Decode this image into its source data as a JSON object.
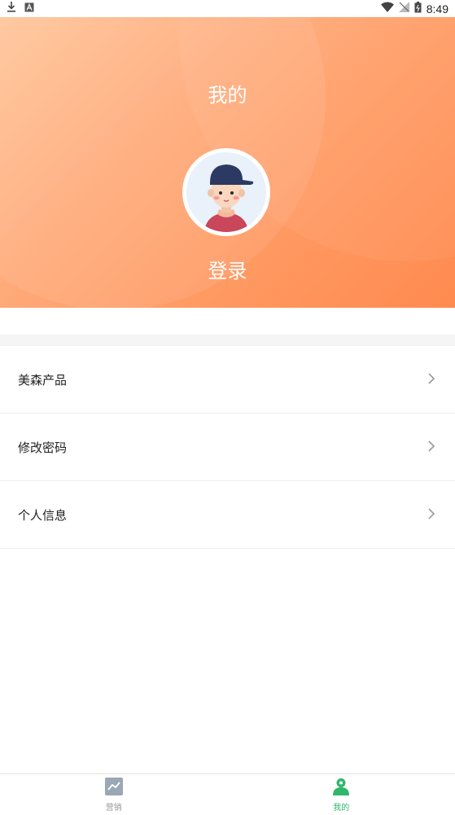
{
  "status_bar": {
    "time": "8:49",
    "left_icons": [
      "download-icon",
      "a-icon"
    ],
    "right_icons": [
      "wifi-icon",
      "no-signal-icon",
      "battery-icon"
    ]
  },
  "header": {
    "title": "我的",
    "login_label": "登录",
    "gradient_colors": [
      "#ffc59a",
      "#ff8a4f"
    ]
  },
  "menu": {
    "items": [
      {
        "label": "美森产品"
      },
      {
        "label": "修改密码"
      },
      {
        "label": "个人信息"
      }
    ]
  },
  "tabbar": {
    "tabs": [
      {
        "label": "营销",
        "icon": "chart-icon",
        "active": false
      },
      {
        "label": "我的",
        "icon": "person-icon",
        "active": true
      }
    ],
    "active_color": "#2fb66a",
    "inactive_color": "#999999"
  }
}
